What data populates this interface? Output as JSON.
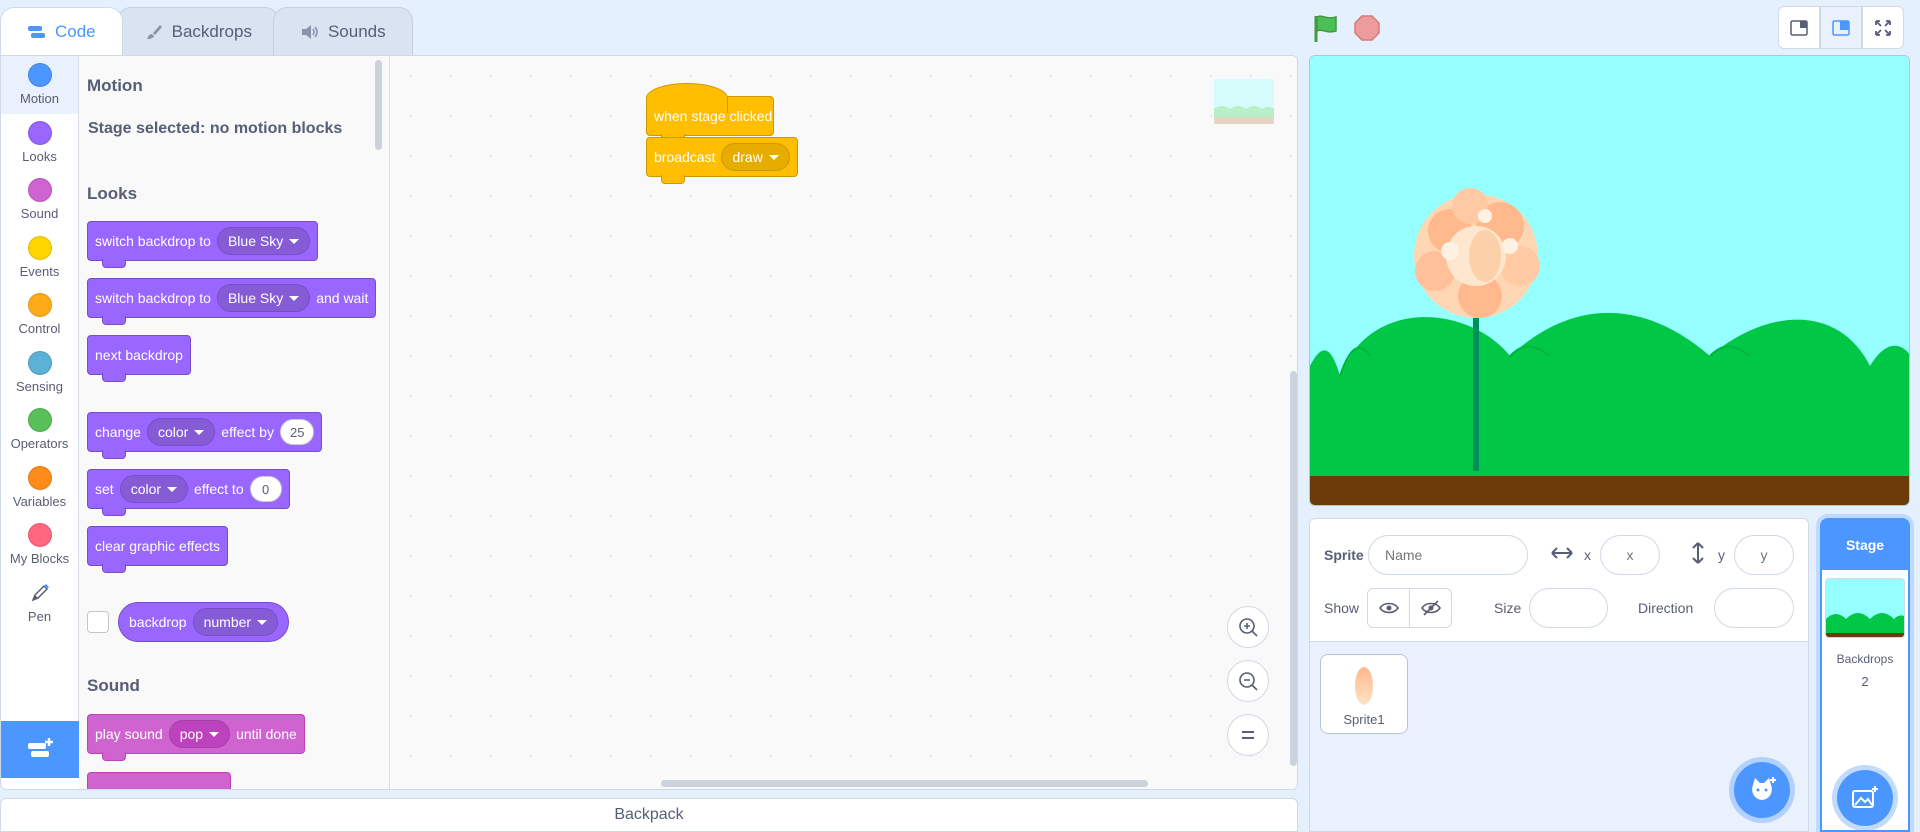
{
  "tabs": [
    {
      "label": "Code",
      "active": true
    },
    {
      "label": "Backdrops",
      "active": false
    },
    {
      "label": "Sounds",
      "active": false
    }
  ],
  "categories": [
    {
      "label": "Motion",
      "color": "#4c97ff"
    },
    {
      "label": "Looks",
      "color": "#9966ff"
    },
    {
      "label": "Sound",
      "color": "#cf63cf"
    },
    {
      "label": "Events",
      "color": "#ffbf00"
    },
    {
      "label": "Control",
      "color": "#ffab19"
    },
    {
      "label": "Sensing",
      "color": "#5cb1d6"
    },
    {
      "label": "Operators",
      "color": "#59c059"
    },
    {
      "label": "Variables",
      "color": "#ff8c1a"
    },
    {
      "label": "My Blocks",
      "color": "#ff6680"
    },
    {
      "label": "Pen",
      "icon": "pen-icon"
    }
  ],
  "palette": {
    "motion_heading": "Motion",
    "motion_note": "Stage selected: no motion blocks",
    "looks_heading": "Looks",
    "sound_heading": "Sound",
    "blocks": {
      "switch_backdrop": {
        "text": "switch backdrop to",
        "value": "Blue Sky"
      },
      "switch_backdrop_wait": {
        "text": "switch backdrop to",
        "value": "Blue Sky",
        "suffix": "and wait"
      },
      "next_backdrop": {
        "text": "next backdrop"
      },
      "change_effect": {
        "text": "change",
        "value": "color",
        "middle": "effect by",
        "number": "25"
      },
      "set_effect": {
        "text": "set",
        "value": "color",
        "middle": "effect to",
        "number": "0"
      },
      "clear_effects": {
        "text": "clear graphic effects"
      },
      "backdrop_reporter": {
        "text": "backdrop",
        "value": "number"
      },
      "play_sound": {
        "text": "play sound",
        "value": "pop",
        "suffix": "until done"
      }
    }
  },
  "script": {
    "hat": "when stage clicked",
    "broadcast": "broadcast",
    "broadcast_value": "draw"
  },
  "backpack": "Backpack",
  "sprite_info": {
    "sprite_label": "Sprite",
    "name_placeholder": "Name",
    "x_label": "x",
    "x_placeholder": "x",
    "y_label": "y",
    "y_placeholder": "y",
    "show_label": "Show",
    "size_label": "Size",
    "direction_label": "Direction"
  },
  "sprites": [
    {
      "name": "Sprite1"
    }
  ],
  "stage_panel": {
    "title": "Stage",
    "backdrops_label": "Backdrops",
    "backdrops_count": "2"
  },
  "colors": {
    "accent": "#4c97ff",
    "looks": "#9966ff",
    "sound": "#cf63cf",
    "events": "#ffbf00",
    "sky": "#96ffff",
    "grass": "#00c846",
    "ground": "#6b3c0a"
  }
}
